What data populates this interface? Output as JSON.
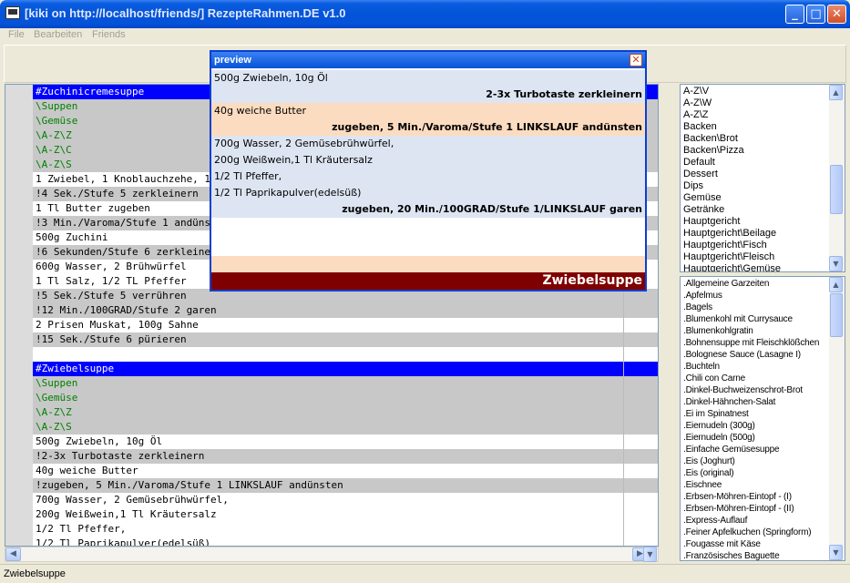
{
  "window": {
    "title": "[kiki on http://localhost/friends/] RezepteRahmen.DE v1.0"
  },
  "menu": {
    "items": [
      "File",
      "Bearbeiten",
      "Friends"
    ]
  },
  "editor": {
    "lines": [
      {
        "text": "#Zuchinicremesuppe",
        "style": "blue"
      },
      {
        "text": "\\Suppen",
        "style": "graygreen"
      },
      {
        "text": "\\Gemüse",
        "style": "graygreen"
      },
      {
        "text": "\\A-Z\\Z",
        "style": "graygreen"
      },
      {
        "text": "\\A-Z\\C",
        "style": "graygreen"
      },
      {
        "text": "\\A-Z\\S",
        "style": "graygreen"
      },
      {
        "text": "1 Zwiebel, 1 Knoblauchzehe, 10g Öl",
        "style": "plain"
      },
      {
        "text": "!4 Sek./Stufe 5 zerkleinern",
        "style": "gray"
      },
      {
        "text": "1 Tl Butter zugeben",
        "style": "plain"
      },
      {
        "text": "!3 Min./Varoma/Stufe 1 andünsten",
        "style": "gray"
      },
      {
        "text": "500g Zuchini",
        "style": "plain"
      },
      {
        "text": "!6 Sekunden/Stufe 6 zerkleinern",
        "style": "gray"
      },
      {
        "text": "600g Wasser, 2 Brühwürfel",
        "style": "plain"
      },
      {
        "text": "1 Tl Salz, 1/2 TL Pfeffer",
        "style": "plain"
      },
      {
        "text": "!5 Sek./Stufe 5 verrühren",
        "style": "gray"
      },
      {
        "text": "!12 Min./100GRAD/Stufe 2 garen",
        "style": "gray"
      },
      {
        "text": "2 Prisen Muskat, 100g Sahne",
        "style": "plain"
      },
      {
        "text": "!15 Sek./Stufe 6 pürieren",
        "style": "gray"
      },
      {
        "text": "",
        "style": "plain"
      },
      {
        "text": "#Zwiebelsuppe",
        "style": "blue"
      },
      {
        "text": "\\Suppen",
        "style": "graygreen"
      },
      {
        "text": "\\Gemüse",
        "style": "graygreen"
      },
      {
        "text": "\\A-Z\\Z",
        "style": "graygreen"
      },
      {
        "text": "\\A-Z\\S",
        "style": "graygreen"
      },
      {
        "text": "500g Zwiebeln, 10g Öl",
        "style": "plain"
      },
      {
        "text": "!2-3x Turbotaste zerkleinern",
        "style": "gray"
      },
      {
        "text": "40g weiche Butter",
        "style": "plain"
      },
      {
        "text": "!zugeben, 5 Min./Varoma/Stufe 1 LINKSLAUF andünsten",
        "style": "gray"
      },
      {
        "text": "700g Wasser, 2 Gemüsebrühwürfel,",
        "style": "plain"
      },
      {
        "text": "200g Weißwein,1 Tl Kräutersalz",
        "style": "plain"
      },
      {
        "text": "1/2 Tl Pfeffer,",
        "style": "plain"
      },
      {
        "text": "1/2 Tl Paprikapulver(edelsüß)",
        "style": "plain"
      }
    ]
  },
  "categories": {
    "items": [
      "A-Z\\V",
      "A-Z\\W",
      "A-Z\\Z",
      "Backen",
      "Backen\\Brot",
      "Backen\\Pizza",
      "Default",
      "Dessert",
      "Dips",
      "Gemüse",
      "Getränke",
      "Hauptgericht",
      "Hauptgericht\\Beilage",
      "Hauptgericht\\Fisch",
      "Hauptgericht\\Fleisch",
      "Hauptgericht\\Gemüse"
    ]
  },
  "recipes": {
    "items": [
      ".Allgemeine Garzeiten",
      ".Apfelmus",
      ".Bagels",
      ".Blumenkohl mit Currysauce",
      ".Blumenkohlgratin",
      ".Bohnensuppe mit Fleischklößchen",
      ".Bolognese Sauce (Lasagne I)",
      ".Buchteln",
      ".Chili con Carne",
      ".Dinkel-Buchweizenschrot-Brot",
      ".Dinkel-Hähnchen-Salat",
      ".Ei im Spinatnest",
      ".Eiernudeln (300g)",
      ".Eiernudeln (500g)",
      ".Einfache Gemüsesuppe",
      ".Eis (Joghurt)",
      ".Eis (original)",
      ".Eischnee",
      ".Erbsen-Möhren-Eintopf - (I)",
      ".Erbsen-Möhren-Eintopf - (II)",
      ".Express-Auflauf",
      ".Feiner Apfelkuchen (Springform)",
      ".Fougasse mit Käse",
      ".Französisches Baguette"
    ]
  },
  "preview": {
    "title": "preview",
    "steps": [
      {
        "ingredients": [
          "500g Zwiebeln, 10g Öl"
        ],
        "action": "2-3x Turbotaste zerkleinern",
        "color": "#dde5f2"
      },
      {
        "ingredients": [
          "40g weiche Butter"
        ],
        "action": "zugeben, 5 Min./Varoma/Stufe 1 LINKSLAUF andünsten",
        "color": "#fcdcc0"
      },
      {
        "ingredients": [
          "700g Wasser, 2 Gemüsebrühwürfel,",
          "200g Weißwein,1 Tl Kräutersalz",
          "1/2 Tl Pfeffer,",
          "1/2 Tl Paprikapulver(edelsüß)"
        ],
        "action": "zugeben, 20 Min./100GRAD/Stufe 1/LINKSLAUF garen",
        "color": "#dde5f2"
      }
    ],
    "recipe_name": "Zwiebelsuppe"
  },
  "status": {
    "text": "Zwiebelsuppe"
  }
}
